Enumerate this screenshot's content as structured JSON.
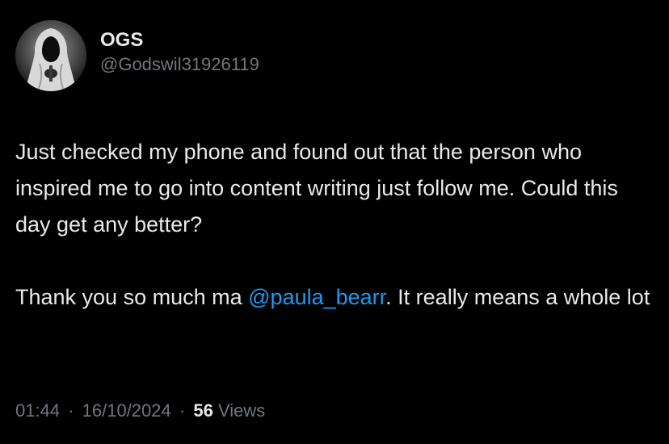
{
  "author": {
    "display_name": "OGS",
    "handle": "@Godswil31926119",
    "avatar_icon": "hooded-figure-avatar"
  },
  "tweet": {
    "paragraph1": "Just checked my phone and found out that the person who inspired me to go into content writing just follow me. Could this day get any better?",
    "paragraph2_before": "Thank you so much ma ",
    "mention": "@paula_bearr",
    "paragraph2_after": ". It really means a whole lot"
  },
  "meta": {
    "time": "01:44",
    "separator": "·",
    "date": "16/10/2024",
    "views_count": "56",
    "views_label": "Views"
  },
  "colors": {
    "background": "#000000",
    "text": "#e7e9ea",
    "secondary": "#71767b",
    "link": "#1d9bf0"
  }
}
